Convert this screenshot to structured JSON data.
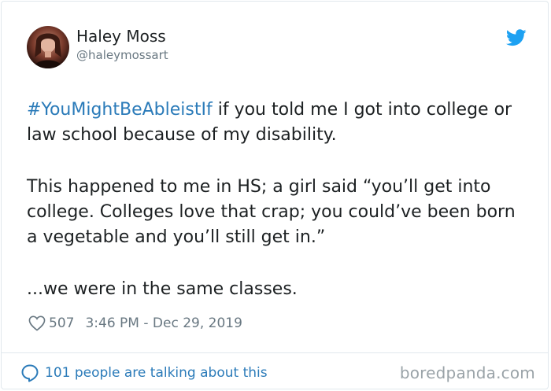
{
  "author": {
    "name": "Haley Moss",
    "handle": "@haleymossart",
    "avatar_icon": "profile-photo"
  },
  "platform_icon": "twitter-bird-icon",
  "tweet": {
    "hashtag": "#YouMightBeAbleistIf",
    "line1_rest": " if you told me I got into college or law school because of my disability.",
    "paragraph2": "This happened to me in HS; a girl said “you’ll get into college. Colleges love that crap; you could’ve been born a vegetable and you’ll still get in.”",
    "paragraph3": "...we were in the same classes."
  },
  "meta": {
    "likes": "507",
    "timestamp": "3:46 PM - Dec 29, 2019"
  },
  "footer": {
    "talking": "101 people are talking about this",
    "watermark": "boredpanda.com"
  },
  "colors": {
    "link": "#2b7bb9",
    "text": "#1c2022",
    "muted": "#697882",
    "twitter_blue": "#1da1f2"
  }
}
